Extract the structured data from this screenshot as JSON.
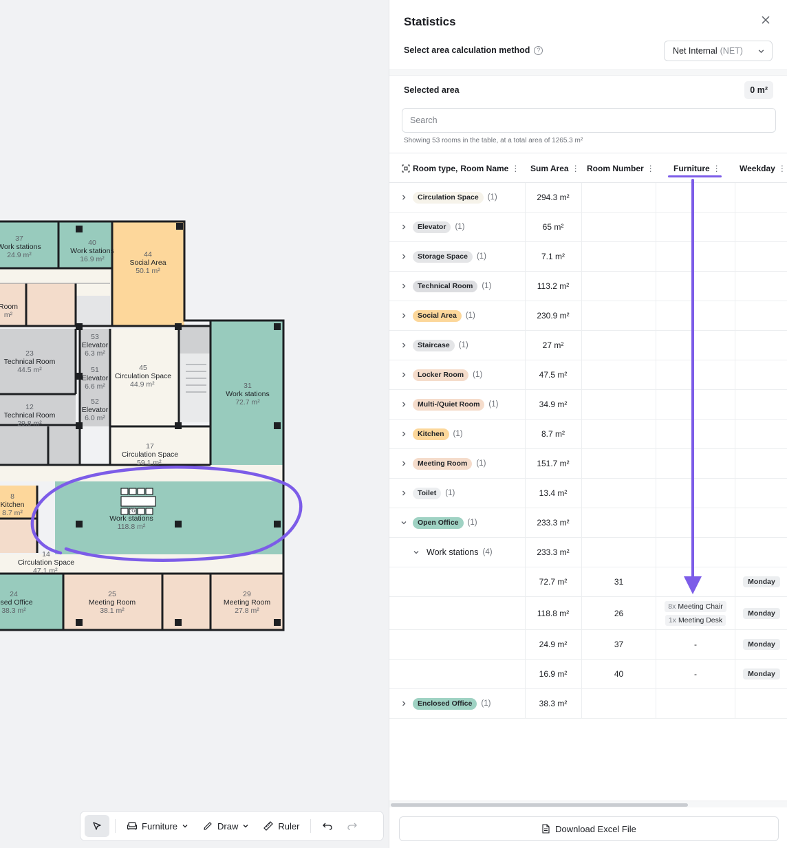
{
  "floorplan": {
    "rooms": [
      {
        "num": "37",
        "name": "Work stations",
        "area": "24.9 m²"
      },
      {
        "num": "40",
        "name": "Work stations",
        "area": "16.9 m²"
      },
      {
        "num": "44",
        "name": "Social Area",
        "area": "50.1 m²"
      },
      {
        "num": "",
        "name": "Room",
        "area": "m²"
      },
      {
        "num": "23",
        "name": "Technical Room",
        "area": "44.5 m²"
      },
      {
        "num": "53",
        "name": "Elevator",
        "area": "6.3 m²"
      },
      {
        "num": "51",
        "name": "Elevator",
        "area": "6.6 m²"
      },
      {
        "num": "52",
        "name": "Elevator",
        "area": "6.0 m²"
      },
      {
        "num": "45",
        "name": "Circulation Space",
        "area": "44.9 m²"
      },
      {
        "num": "31",
        "name": "Work stations",
        "area": "72.7 m²"
      },
      {
        "num": "12",
        "name": "Technical Room",
        "area": "29.8 m²"
      },
      {
        "num": "17",
        "name": "Circulation Space",
        "area": "59.1 m²"
      },
      {
        "num": "8",
        "name": "Kitchen",
        "area": "8.7 m²"
      },
      {
        "num": "26",
        "name": "Work stations",
        "area": "118.8 m²"
      },
      {
        "num": "14",
        "name": "Circulation Space",
        "area": "47.1 m²"
      },
      {
        "num": "24",
        "name": "losed Office",
        "area": "38.3 m²"
      },
      {
        "num": "25",
        "name": "Meeting Room",
        "area": "38.1 m²"
      },
      {
        "num": "29",
        "name": "Meeting Room",
        "area": "27.8 m²"
      }
    ]
  },
  "toolbar": {
    "furniture": "Furniture",
    "draw": "Draw",
    "ruler": "Ruler"
  },
  "panel": {
    "title": "Statistics",
    "method_label": "Select area calculation method",
    "method_value": "Net Internal",
    "method_abbr": "(NET)",
    "selected_label": "Selected area",
    "selected_value": "0 m²",
    "search_placeholder": "Search",
    "showing": "Showing 53 rooms in the table, at a total area of 1265.3 m²",
    "download": "Download Excel File"
  },
  "columns": {
    "room_type": "Room type,",
    "room_name": "Room Name",
    "sum_area": "Sum Area",
    "room_number": "Room Number",
    "furniture": "Furniture",
    "weekday": "Weekday"
  },
  "groups": [
    {
      "label": "Circulation Space",
      "count": "(1)",
      "area": "294.3 m²",
      "color": "#f6f3ea"
    },
    {
      "label": "Elevator",
      "count": "(1)",
      "area": "65 m²",
      "color": "#e4e5e7"
    },
    {
      "label": "Storage Space",
      "count": "(1)",
      "area": "7.1 m²",
      "color": "#e4e5e7"
    },
    {
      "label": "Technical Room",
      "count": "(1)",
      "area": "113.2 m²",
      "color": "#dcdde0"
    },
    {
      "label": "Social Area",
      "count": "(1)",
      "area": "230.9 m²",
      "color": "#fcd79a"
    },
    {
      "label": "Staircase",
      "count": "(1)",
      "area": "27 m²",
      "color": "#e4e5e7"
    },
    {
      "label": "Locker Room",
      "count": "(1)",
      "area": "47.5 m²",
      "color": "#f5dccb"
    },
    {
      "label": "Multi-/Quiet Room",
      "count": "(1)",
      "area": "34.9 m²",
      "color": "#f5dccb"
    },
    {
      "label": "Kitchen",
      "count": "(1)",
      "area": "8.7 m²",
      "color": "#fcd79a"
    },
    {
      "label": "Meeting Room",
      "count": "(1)",
      "area": "151.7 m²",
      "color": "#f5dccb"
    },
    {
      "label": "Toilet",
      "count": "(1)",
      "area": "13.4 m²",
      "color": "#eceef0"
    },
    {
      "label": "Open Office",
      "count": "(1)",
      "area": "233.3 m²",
      "color": "#9fd2c3"
    }
  ],
  "subgroup": {
    "label": "Work stations",
    "count": "(4)",
    "area": "233.3 m²"
  },
  "detail_rows": [
    {
      "area": "72.7 m²",
      "number": "31",
      "furniture": [],
      "weekday": "Monday"
    },
    {
      "area": "118.8 m²",
      "number": "26",
      "furniture": [
        {
          "qty": "8x",
          "name": "Meeting Chair"
        },
        {
          "qty": "1x",
          "name": "Meeting Desk"
        }
      ],
      "weekday": "Monday"
    },
    {
      "area": "24.9 m²",
      "number": "37",
      "furniture_dash": "-",
      "weekday": "Monday"
    },
    {
      "area": "16.9 m²",
      "number": "40",
      "furniture_dash": "-",
      "weekday": "Monday"
    }
  ],
  "last_group": {
    "label": "Enclosed Office",
    "count": "(1)",
    "area": "38.3 m²",
    "color": "#9fd2c3"
  },
  "colors": {
    "accent": "#7c5ce8",
    "workstation": "#98cbbd",
    "social": "#fdd79b",
    "meeting": "#f3dccb",
    "circulation": "#f7f4ec",
    "technical": "#cfd0d2"
  }
}
